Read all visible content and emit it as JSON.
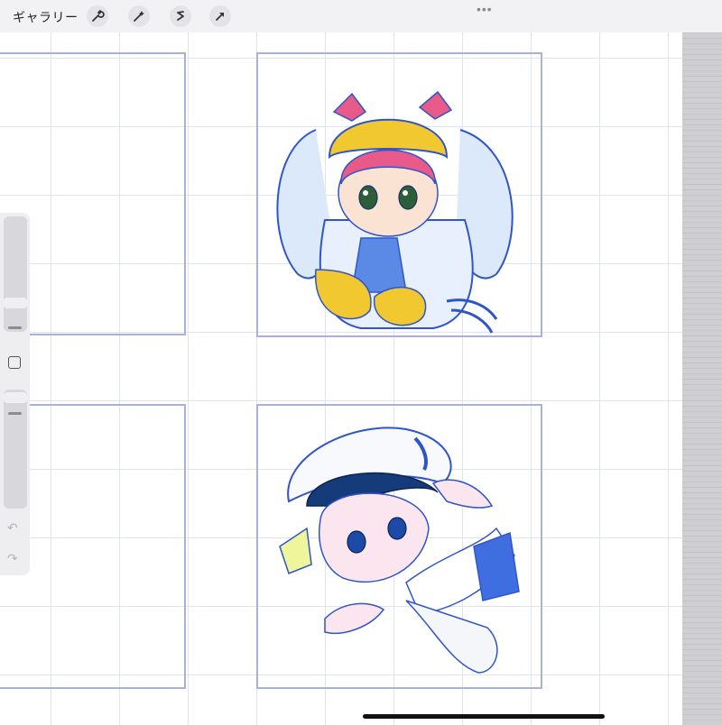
{
  "header": {
    "gallery_label": "ギャラリー",
    "tools": [
      {
        "name": "wrench-icon"
      },
      {
        "name": "magic-wand-icon"
      },
      {
        "name": "selection-s-icon"
      },
      {
        "name": "arrow-transform-icon"
      }
    ],
    "more_icon": "more-dots-icon"
  },
  "sidebar": {
    "icons": [
      "brush-size-slider",
      "modify-button",
      "opacity-slider",
      "undo-icon",
      "redo-icon"
    ]
  },
  "colors": {
    "grid": "#dfe3ee",
    "frame": "#a9b2d3",
    "sketch_blue": "#2f55c9",
    "yellow": "#f1c82f",
    "pink": "#e85a8a"
  }
}
